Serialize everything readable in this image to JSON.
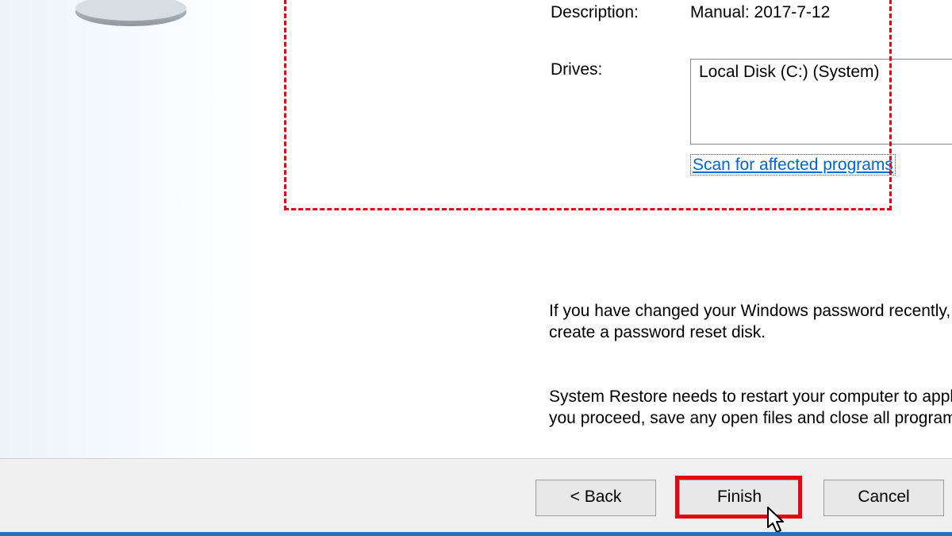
{
  "details": {
    "description_label": "Description:",
    "description_value": "Manual: 2017-7-12",
    "drives_label": "Drives:",
    "drives_value": "Local Disk (C:) (System)",
    "scan_link": "Scan for affected programs"
  },
  "paragraphs": {
    "p1": "If you have changed your Windows password recently, we recommend that you create a password reset disk.",
    "p2": "System Restore needs to restart your computer to apply these changes. Before you proceed, save any open files and close all programs."
  },
  "buttons": {
    "back": "< Back",
    "finish": "Finish",
    "cancel": "Cancel"
  }
}
